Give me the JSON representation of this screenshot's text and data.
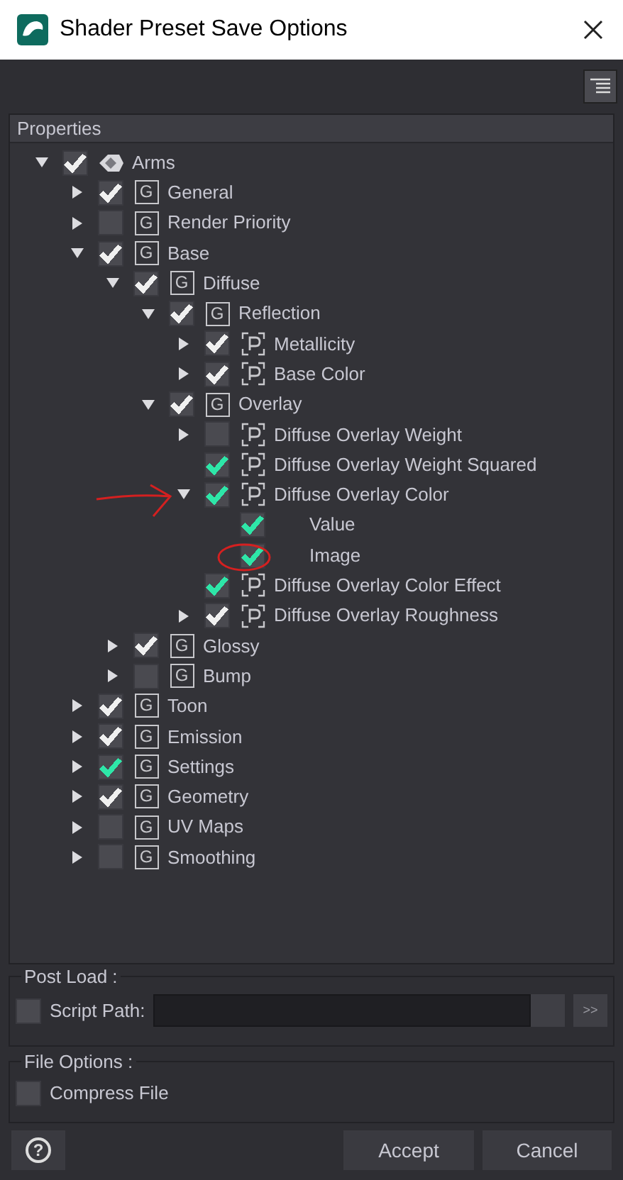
{
  "window": {
    "title": "Shader Preset Save Options"
  },
  "properties": {
    "header": "Properties",
    "tree": [
      {
        "label": "Arms",
        "kind": "object",
        "expanded": true,
        "checked": true,
        "color": "#f0f0f0",
        "children": [
          {
            "label": "General",
            "kind": "group",
            "badge": "G",
            "expanded": false,
            "checked": true,
            "color": "#f0f0f0"
          },
          {
            "label": "Render Priority",
            "kind": "group",
            "badge": "G",
            "expanded": false,
            "checked": false
          },
          {
            "label": "Base",
            "kind": "group",
            "badge": "G",
            "expanded": true,
            "checked": true,
            "color": "#f0f0f0",
            "children": [
              {
                "label": "Diffuse",
                "kind": "group",
                "badge": "G",
                "expanded": true,
                "checked": true,
                "color": "#f0f0f0",
                "children": [
                  {
                    "label": "Reflection",
                    "kind": "group",
                    "badge": "G",
                    "expanded": true,
                    "checked": true,
                    "color": "#f0f0f0",
                    "children": [
                      {
                        "label": "Metallicity",
                        "kind": "property",
                        "expanded": false,
                        "checked": true,
                        "color": "#f0f0f0"
                      },
                      {
                        "label": "Base Color",
                        "kind": "property",
                        "expanded": false,
                        "checked": true,
                        "color": "#f0f0f0"
                      }
                    ]
                  },
                  {
                    "label": "Overlay",
                    "kind": "group",
                    "badge": "G",
                    "expanded": true,
                    "checked": true,
                    "color": "#f0f0f0",
                    "children": [
                      {
                        "label": "Diffuse Overlay Weight",
                        "kind": "property",
                        "expanded": false,
                        "checked": false
                      },
                      {
                        "label": "Diffuse Overlay Weight Squared",
                        "kind": "property",
                        "checked": true,
                        "color": "#2ee6a8"
                      },
                      {
                        "label": "Diffuse Overlay Color",
                        "kind": "property",
                        "expanded": true,
                        "checked": true,
                        "color": "#2ee6a8",
                        "children": [
                          {
                            "label": "Value",
                            "checked": true,
                            "color": "#2ee6a8"
                          },
                          {
                            "label": "Image",
                            "checked": true,
                            "color": "#2ee6a8"
                          }
                        ]
                      },
                      {
                        "label": "Diffuse Overlay Color Effect",
                        "kind": "property",
                        "checked": true,
                        "color": "#2ee6a8"
                      },
                      {
                        "label": "Diffuse Overlay Roughness",
                        "kind": "property",
                        "expanded": false,
                        "checked": true,
                        "color": "#f0f0f0"
                      }
                    ]
                  }
                ]
              },
              {
                "label": "Glossy",
                "kind": "group",
                "badge": "G",
                "expanded": false,
                "checked": true,
                "color": "#f0f0f0"
              },
              {
                "label": "Bump",
                "kind": "group",
                "badge": "G",
                "expanded": false,
                "checked": false
              }
            ]
          },
          {
            "label": "Toon",
            "kind": "group",
            "badge": "G",
            "expanded": false,
            "checked": true,
            "color": "#f0f0f0"
          },
          {
            "label": "Emission",
            "kind": "group",
            "badge": "G",
            "expanded": false,
            "checked": true,
            "color": "#f0f0f0"
          },
          {
            "label": "Settings",
            "kind": "group",
            "badge": "G",
            "expanded": false,
            "checked": true,
            "color": "#2ee6a8"
          },
          {
            "label": "Geometry",
            "kind": "group",
            "badge": "G",
            "expanded": false,
            "checked": true,
            "color": "#f0f0f0"
          },
          {
            "label": "UV Maps",
            "kind": "group",
            "badge": "G",
            "expanded": false,
            "checked": false
          },
          {
            "label": "Smoothing",
            "kind": "group",
            "badge": "G",
            "expanded": false,
            "checked": false
          }
        ]
      }
    ]
  },
  "post_load": {
    "title": "Post Load :",
    "script_path": {
      "label": "Script Path:",
      "checked": false,
      "browse": ">>"
    }
  },
  "file_options": {
    "title": "File Options :",
    "compress": {
      "label": "Compress File",
      "checked": false
    }
  },
  "buttons": {
    "help": "?",
    "accept": "Accept",
    "cancel": "Cancel"
  }
}
